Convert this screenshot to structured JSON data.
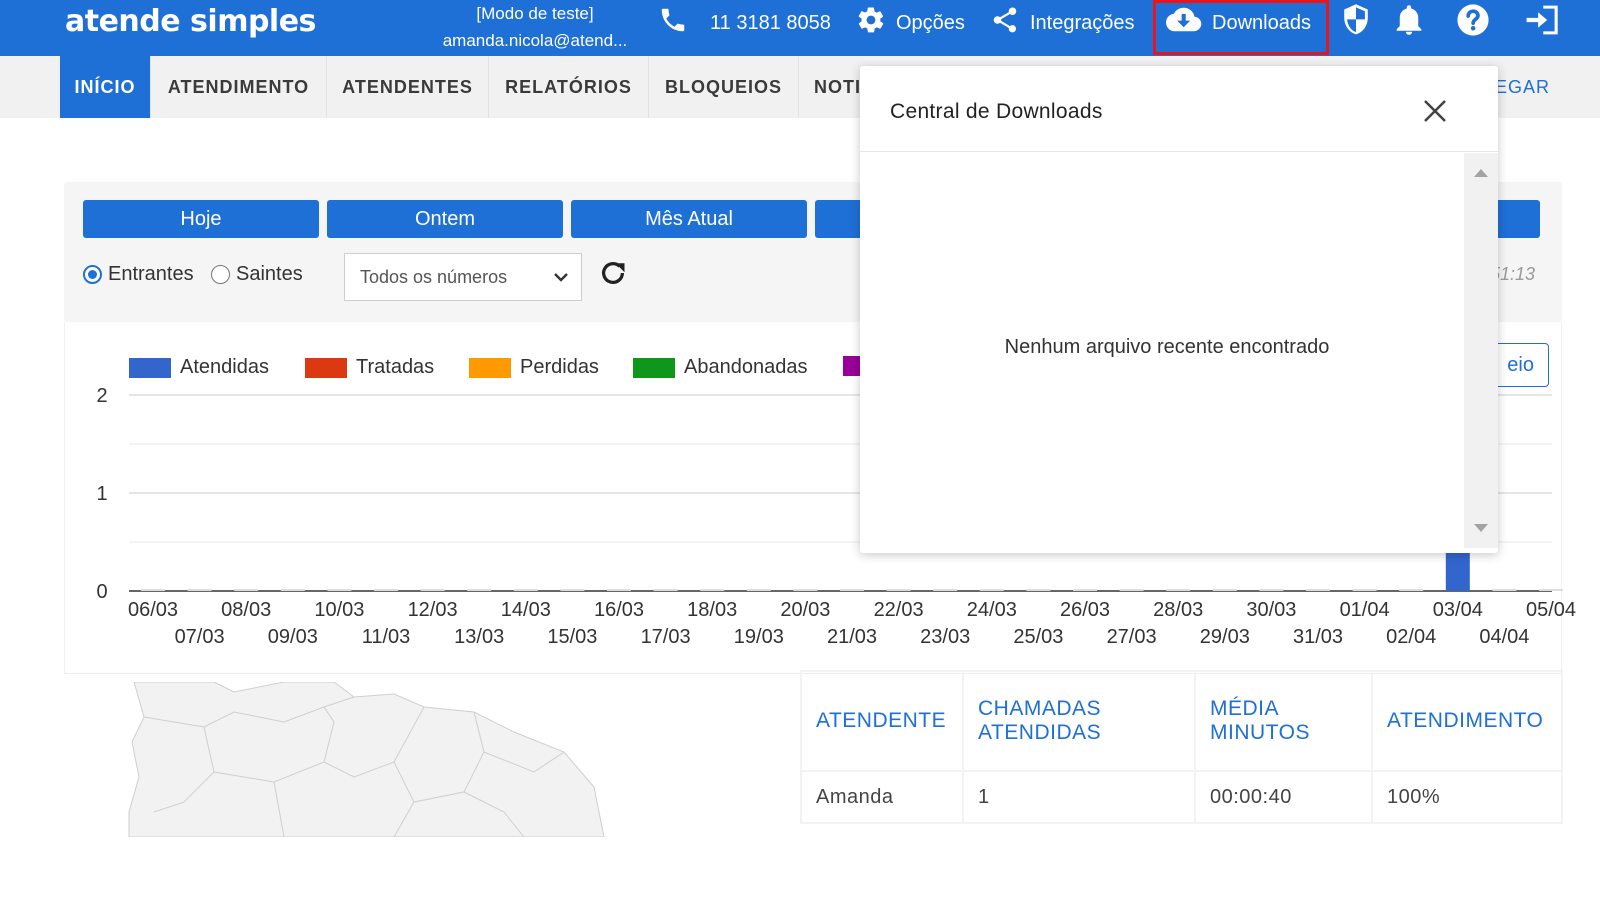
{
  "header": {
    "logo": "atende simples",
    "mode": "[Modo de teste]",
    "user": "amanda.nicola@atend...",
    "phone": "11 3181 8058",
    "options": "Opções",
    "integrations": "Integrações",
    "downloads": "Downloads",
    "icons": [
      "phone-icon",
      "gear-icon",
      "share-icon",
      "cloud-download-icon",
      "shield-icon",
      "bell-icon",
      "help-icon",
      "logout-icon"
    ]
  },
  "nav": {
    "tabs": [
      "INÍCIO",
      "ATENDIMENTO",
      "ATENDENTES",
      "RELATÓRIOS",
      "BLOQUEIOS",
      "NOTI"
    ],
    "right_fragment": "EGAR"
  },
  "filters": {
    "periods": [
      "Hoje",
      "Ontem",
      "Mês Atual"
    ],
    "radio_incoming": "Entrantes",
    "radio_outgoing": "Saintes",
    "selected_radio": "Entrantes",
    "number_select": "Todos os números",
    "time_fragment": "51:13"
  },
  "chart_outline_button": "eio",
  "chart_data": {
    "type": "bar",
    "series": [
      {
        "name": "Atendidas",
        "color": "#3366cc"
      },
      {
        "name": "Tratadas",
        "color": "#dc3912"
      },
      {
        "name": "Perdidas",
        "color": "#ff9900"
      },
      {
        "name": "Abandonadas",
        "color": "#109618"
      },
      {
        "name": "",
        "color": "#990099"
      }
    ],
    "categories": [
      "06/03",
      "07/03",
      "08/03",
      "09/03",
      "10/03",
      "11/03",
      "12/03",
      "13/03",
      "14/03",
      "15/03",
      "16/03",
      "17/03",
      "18/03",
      "19/03",
      "20/03",
      "21/03",
      "22/03",
      "23/03",
      "24/03",
      "25/03",
      "26/03",
      "27/03",
      "28/03",
      "29/03",
      "30/03",
      "31/03",
      "01/04",
      "02/04",
      "03/04",
      "04/04",
      "05/04"
    ],
    "atendidas_values": [
      0,
      0,
      0,
      0,
      0,
      0,
      0,
      0,
      0,
      0,
      0,
      0,
      0,
      0,
      0,
      0,
      0,
      0,
      0,
      0,
      0,
      0,
      0,
      0,
      0,
      0,
      0,
      0,
      1,
      0,
      0
    ],
    "y_ticks": [
      "0",
      "1",
      "2"
    ],
    "ylim": [
      0,
      2
    ],
    "grid": true,
    "legend": "top"
  },
  "table": {
    "headers": [
      [
        "ATENDENTE"
      ],
      [
        "CHAMADAS",
        "ATENDIDAS"
      ],
      [
        "MÉDIA",
        "MINUTOS"
      ],
      [
        "ATENDIMENTO"
      ]
    ],
    "rows": [
      [
        "Amanda",
        "1",
        "00:00:40",
        "100%"
      ]
    ]
  },
  "popup": {
    "title": "Central de Downloads",
    "empty_message": "Nenhum arquivo recente encontrado"
  },
  "colors": {
    "primary": "#1e6fd6",
    "highlight_border": "#e8161c"
  }
}
